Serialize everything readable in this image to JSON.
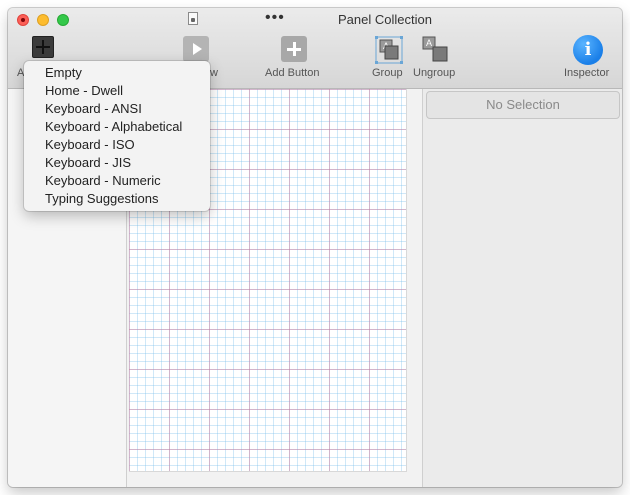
{
  "window": {
    "title": "Panel Collection"
  },
  "toolbar": {
    "add_panel_label": "A",
    "preview_label": "w",
    "add_button_label": "Add Button",
    "group_label": "Group",
    "ungroup_label": "Ungroup",
    "inspector_label": "Inspector",
    "ellipsis": "•••",
    "info_glyph": "i"
  },
  "inspector": {
    "empty_text": "No Selection"
  },
  "menu": {
    "items": [
      {
        "label": "Empty"
      },
      {
        "label": "Home - Dwell"
      },
      {
        "label": "Keyboard - ANSI"
      },
      {
        "label": "Keyboard - Alphabetical"
      },
      {
        "label": "Keyboard - ISO"
      },
      {
        "label": "Keyboard - JIS"
      },
      {
        "label": "Keyboard - Numeric"
      },
      {
        "label": "Typing Suggestions"
      }
    ]
  },
  "colors": {
    "accent_info": "#1a7fe8",
    "grid_major": "#d678a0",
    "grid_minor": "#78bee8"
  }
}
